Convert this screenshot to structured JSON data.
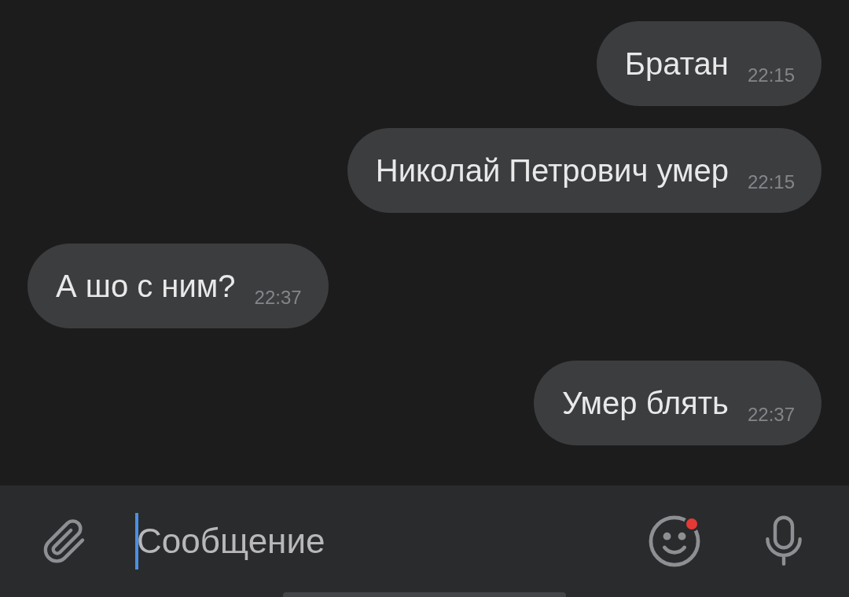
{
  "messages": [
    {
      "kind": "outgoing",
      "text": "Братан",
      "time": "22:15"
    },
    {
      "kind": "outgoing",
      "text": "Николай Петрович умер",
      "time": "22:15"
    },
    {
      "kind": "incoming",
      "text": "А шо с ним?",
      "time": "22:37"
    },
    {
      "kind": "outgoing",
      "text": "Умер блять",
      "time": "22:37"
    }
  ],
  "composer": {
    "placeholder": "Сообщение",
    "emoji_badge": true
  }
}
